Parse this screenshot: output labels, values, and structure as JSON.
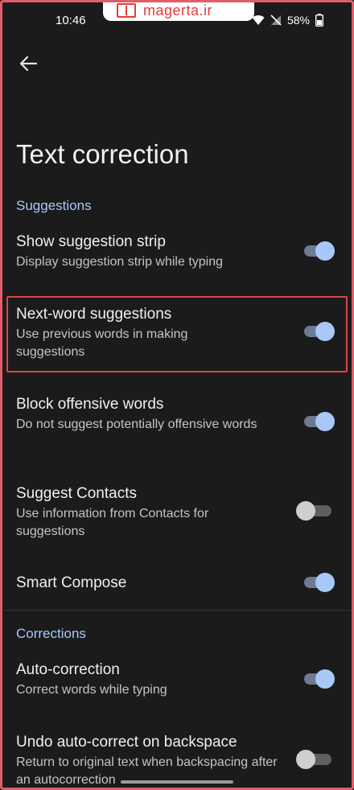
{
  "status_bar": {
    "time": "10:46",
    "battery_percent": "58%",
    "watermark_text": "magerta.ir",
    "wifi_icon": "wifi-icon",
    "signal_icon": "no-signal-icon",
    "battery_icon": "battery-icon"
  },
  "header": {
    "back_icon": "arrow-back-icon",
    "title": "Text correction"
  },
  "sections": {
    "suggestions": "Suggestions",
    "corrections": "Corrections"
  },
  "settings": [
    {
      "title": "Show suggestion strip",
      "description": "Display suggestion strip while typing",
      "enabled": true
    },
    {
      "title": "Next-word suggestions",
      "description": "Use previous words in making suggestions",
      "enabled": true
    },
    {
      "title": "Block offensive words",
      "description": "Do not suggest potentially offensive words",
      "enabled": true
    },
    {
      "title": "Suggest Contacts",
      "description": "Use information from Contacts for suggestions",
      "enabled": false
    },
    {
      "title": "Smart Compose",
      "description": "",
      "enabled": true
    },
    {
      "title": "Auto-correction",
      "description": "Correct words while typing",
      "enabled": true
    },
    {
      "title": "Undo auto-correct on backspace",
      "description": "Return to original text when backspacing after an autocorrection",
      "enabled": false
    }
  ],
  "colors": {
    "background": "#1b1b1b",
    "accent": "#a8c8f8",
    "highlight_border": "#d94646"
  }
}
